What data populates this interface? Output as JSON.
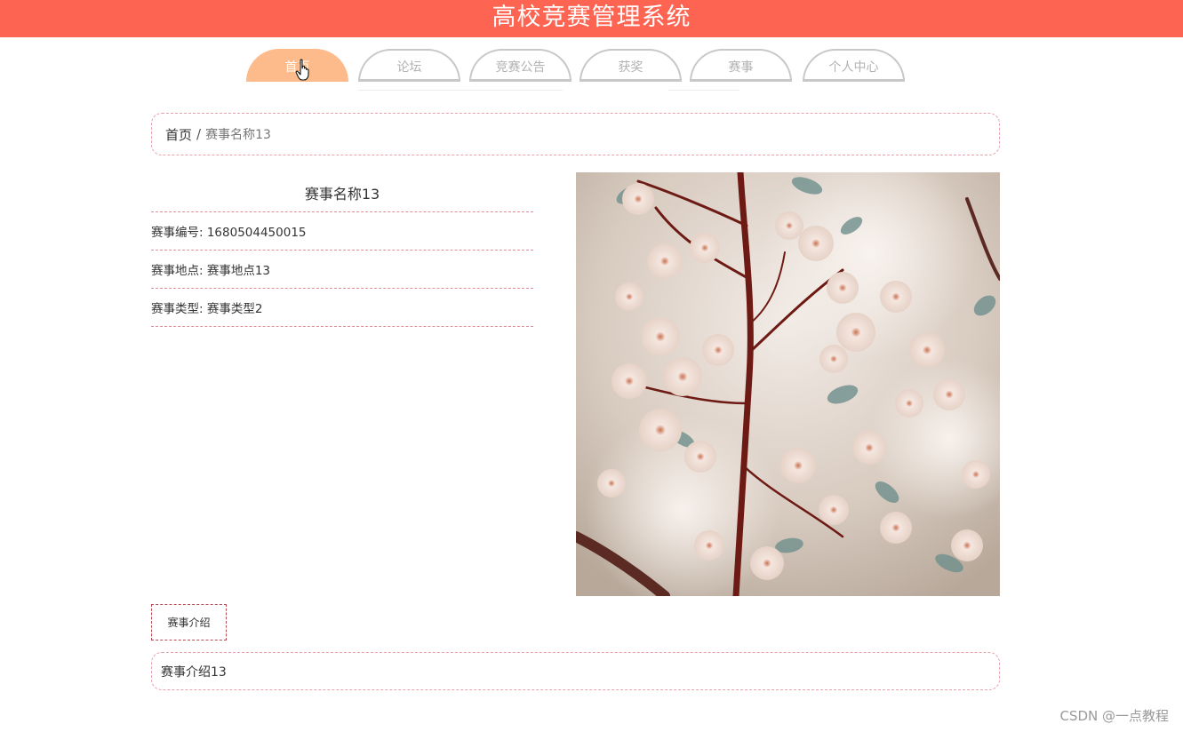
{
  "header": {
    "title": "高校竞赛管理系统"
  },
  "nav": {
    "tabs": [
      {
        "label": "首页",
        "active": true
      },
      {
        "label": "论坛",
        "active": false
      },
      {
        "label": "竞赛公告",
        "active": false
      },
      {
        "label": "获奖",
        "active": false
      },
      {
        "label": "赛事",
        "active": false
      },
      {
        "label": "个人中心",
        "active": false
      }
    ]
  },
  "breadcrumb": {
    "home": "首页",
    "separator": "/",
    "current": "赛事名称13"
  },
  "detail": {
    "name": "赛事名称13",
    "number": "赛事编号: 1680504450015",
    "location": "赛事地点: 赛事地点13",
    "type": "赛事类型: 赛事类型2"
  },
  "intro": {
    "tab_label": "赛事介绍",
    "content": "赛事介绍13"
  },
  "watermark": "CSDN @一点教程",
  "colors": {
    "header": "#fd6452",
    "active_tab": "#fdbb8c",
    "dashed_border": "#e8a0ad"
  }
}
